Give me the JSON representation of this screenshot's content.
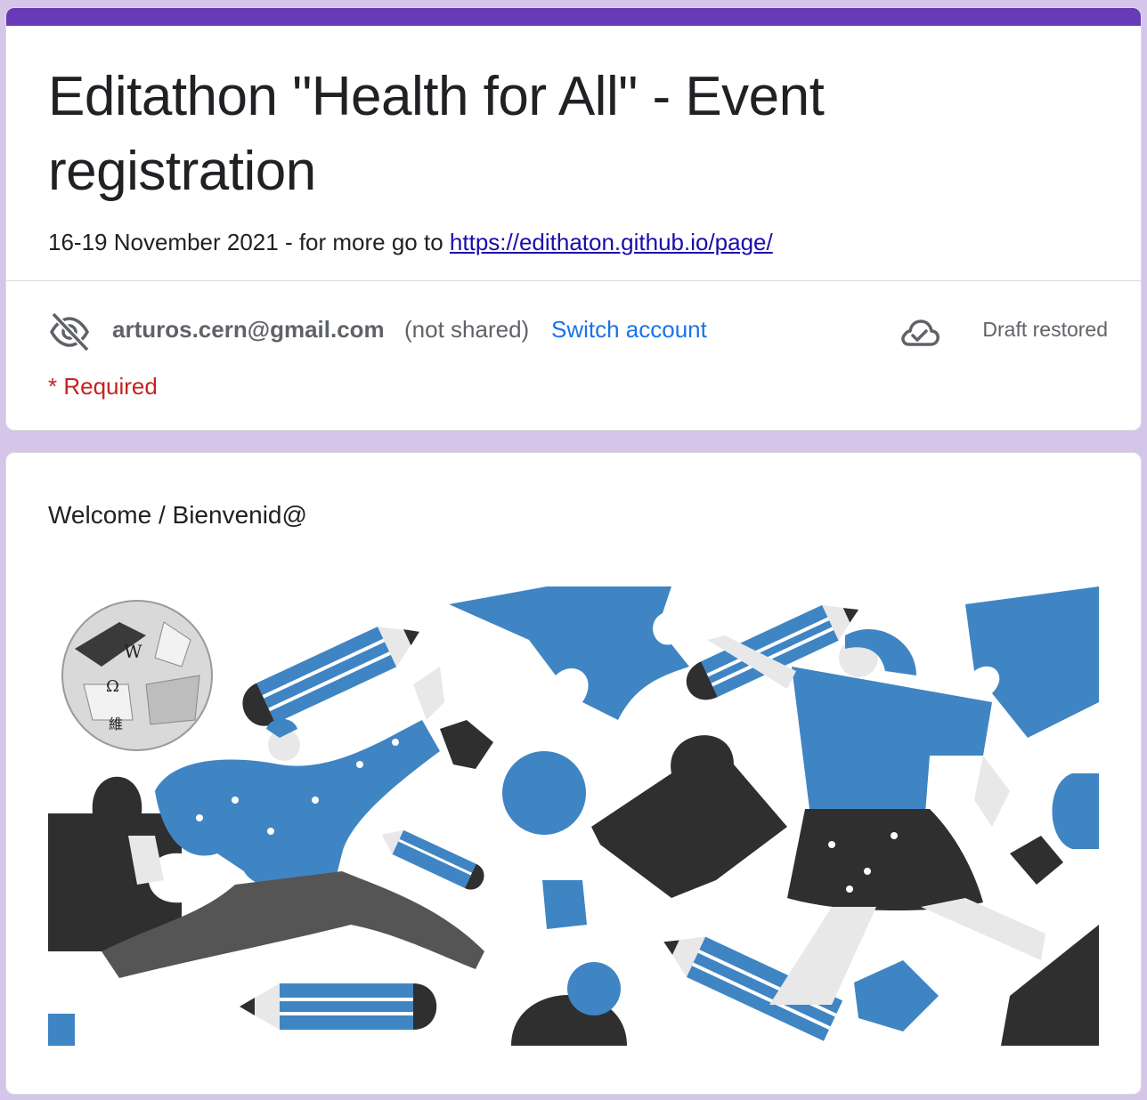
{
  "form": {
    "title": "Editathon \"Health for All\" - Event registration",
    "description_prefix": "16-19 November 2021 - for more go to ",
    "description_link": "https://edithaton.github.io/page/",
    "account_email": "arturos.cern@gmail.com",
    "not_shared": "(not shared)",
    "switch_account": "Switch account",
    "draft_status": "Draft restored",
    "required_note": "* Required"
  },
  "section": {
    "title": "Welcome / Bienvenid@"
  },
  "icons": {
    "eye": "eye-off-icon",
    "cloud": "cloud-done-icon"
  },
  "colors": {
    "accent": "#673ab7",
    "background": "#d4c5e9",
    "link": "#1a73e8",
    "required": "#c5221f",
    "illustration_blue": "#3f85c3",
    "illustration_dark": "#2f2f2f"
  }
}
